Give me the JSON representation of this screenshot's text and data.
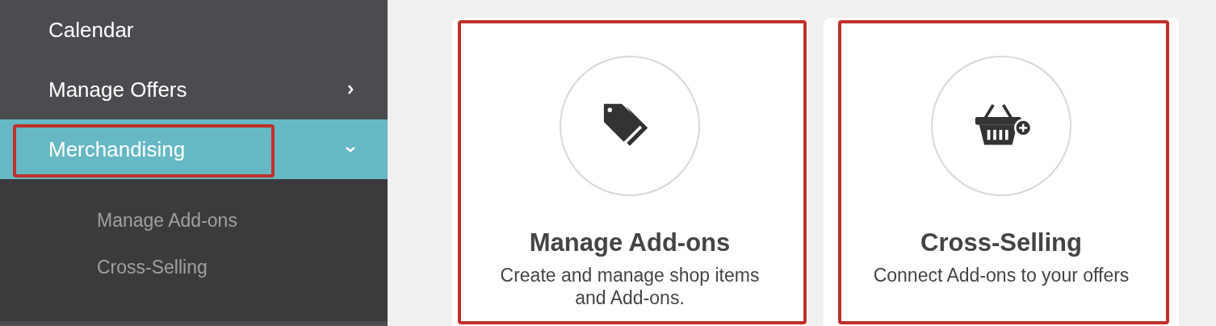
{
  "sidebar": {
    "items": [
      {
        "label": "Calendar",
        "has_children": false,
        "selected": false,
        "highlighted": false
      },
      {
        "label": "Manage Offers",
        "has_children": true,
        "expanded": false,
        "selected": false,
        "highlighted": false
      },
      {
        "label": "Merchandising",
        "has_children": true,
        "expanded": true,
        "selected": true,
        "highlighted": true,
        "children": [
          {
            "label": "Manage Add-ons"
          },
          {
            "label": "Cross-Selling"
          }
        ]
      }
    ]
  },
  "cards": [
    {
      "kind": "tags",
      "title": "Manage Add-ons",
      "description": "Create and manage shop items and Add-ons.",
      "highlighted": true
    },
    {
      "kind": "basket",
      "title": "Cross-Selling",
      "description": "Connect Add-ons to your offers",
      "highlighted": true
    }
  ]
}
